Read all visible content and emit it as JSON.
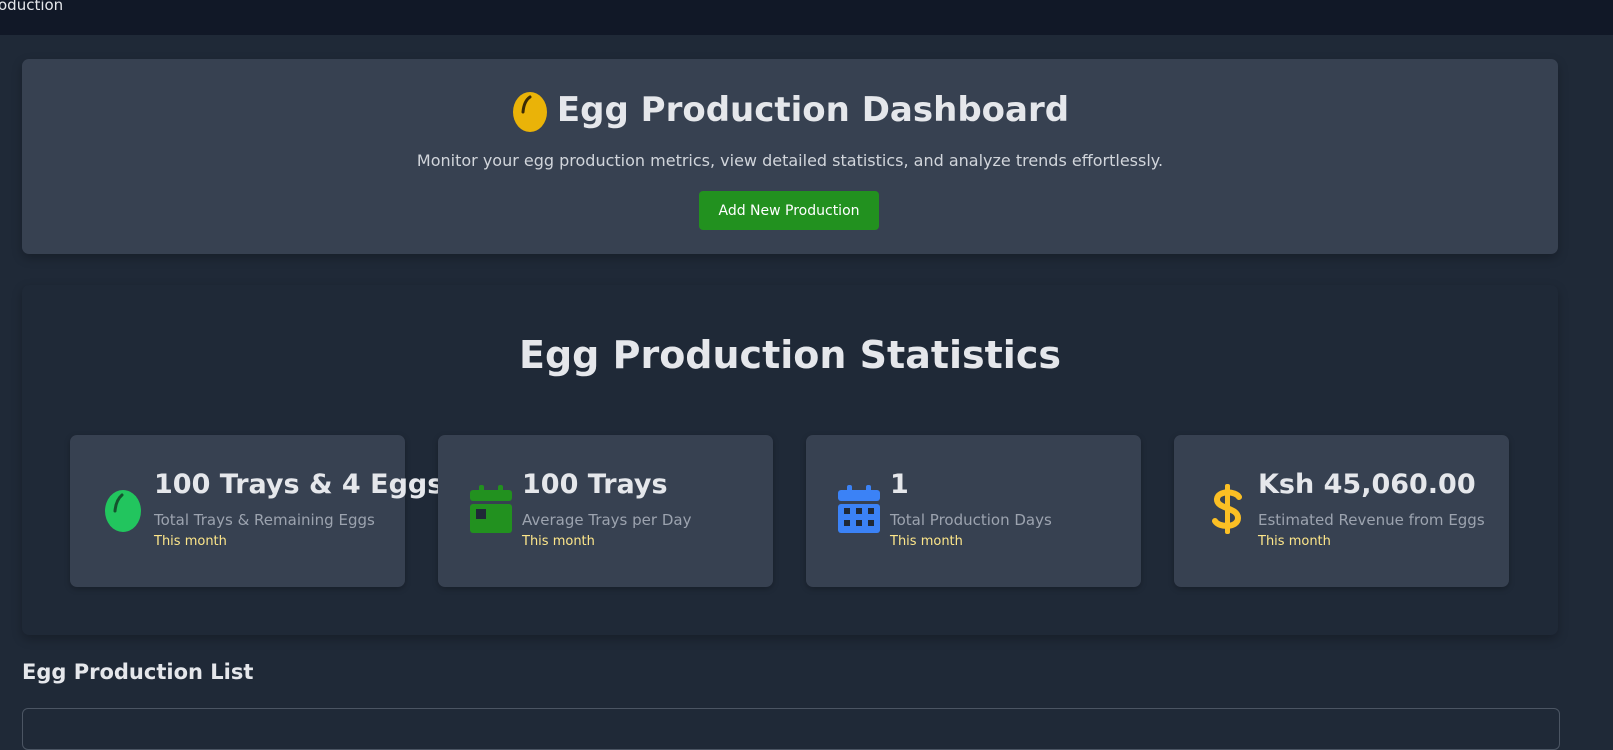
{
  "topbar": {
    "text": "oduction"
  },
  "hero": {
    "title": "Egg Production Dashboard",
    "icon": "egg-icon",
    "subtitle": "Monitor your egg production metrics, view detailed statistics, and analyze trends effortlessly.",
    "button_label": "Add New Production"
  },
  "stats": {
    "title": "Egg Production Statistics",
    "cards": [
      {
        "icon": "egg-icon",
        "icon_color": "#22c55e",
        "value": "100 Trays & 4 Eggs",
        "label": "Total Trays & Remaining Eggs",
        "period": "This month"
      },
      {
        "icon": "calendar-day-icon",
        "icon_color": "#22911f",
        "value": "100 Trays",
        "label": "Average Trays per Day",
        "period": "This month"
      },
      {
        "icon": "calendar-icon",
        "icon_color": "#3b82f6",
        "value": "1",
        "label": "Total Production Days",
        "period": "This month"
      },
      {
        "icon": "dollar-icon",
        "icon_color": "#fbbf24",
        "value": "Ksh 45,060.00",
        "label": "Estimated Revenue from Eggs",
        "period": "This month"
      }
    ]
  },
  "list": {
    "title": "Egg Production List"
  },
  "colors": {
    "accent_green": "#22911f",
    "period_text": "#fde68a"
  }
}
